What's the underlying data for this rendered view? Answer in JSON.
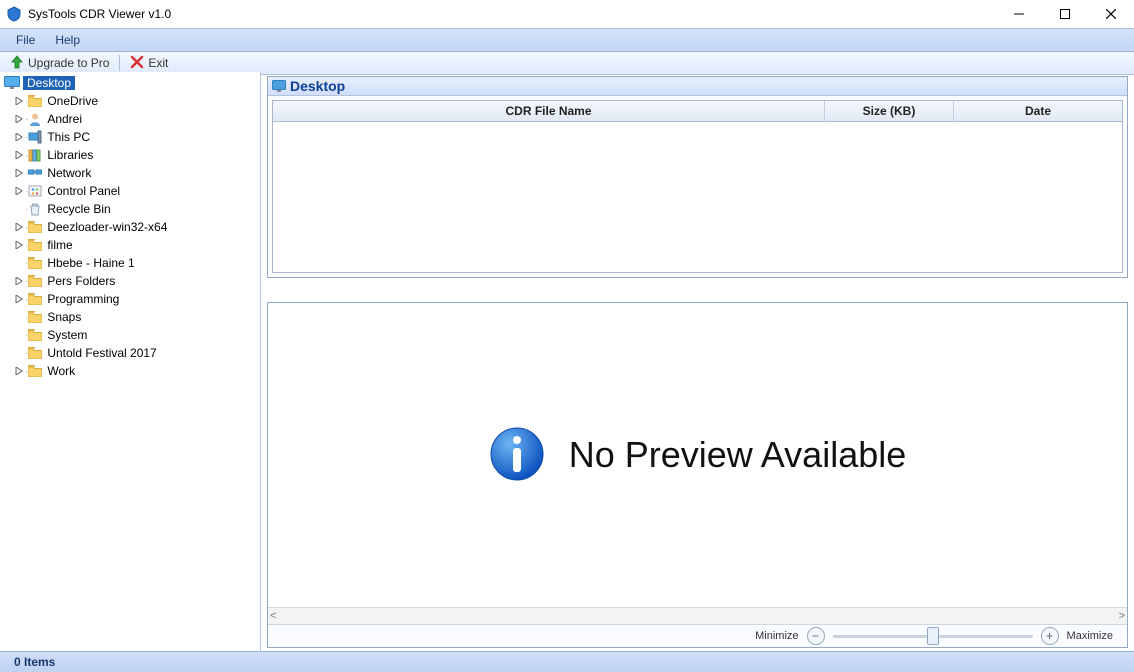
{
  "window": {
    "title": "SysTools CDR Viewer v1.0"
  },
  "menubar": {
    "file": "File",
    "help": "Help"
  },
  "toolbar": {
    "upgrade": "Upgrade to Pro",
    "exit": "Exit"
  },
  "sidebar": {
    "items": [
      {
        "label": "Desktop",
        "icon": "desktop",
        "depth": 0,
        "expander": "",
        "selected": true
      },
      {
        "label": "OneDrive",
        "icon": "folder",
        "depth": 1,
        "expander": ">"
      },
      {
        "label": "Andrei",
        "icon": "user",
        "depth": 1,
        "expander": ">"
      },
      {
        "label": "This PC",
        "icon": "pc",
        "depth": 1,
        "expander": ">"
      },
      {
        "label": "Libraries",
        "icon": "libraries",
        "depth": 1,
        "expander": ">"
      },
      {
        "label": "Network",
        "icon": "network",
        "depth": 1,
        "expander": ">"
      },
      {
        "label": "Control Panel",
        "icon": "control-panel",
        "depth": 1,
        "expander": ">"
      },
      {
        "label": "Recycle Bin",
        "icon": "recycle",
        "depth": 1,
        "expander": ""
      },
      {
        "label": "Deezloader-win32-x64",
        "icon": "folder",
        "depth": 1,
        "expander": ">"
      },
      {
        "label": "filme",
        "icon": "folder",
        "depth": 1,
        "expander": ">"
      },
      {
        "label": "Hbebe - Haine 1",
        "icon": "folder",
        "depth": 1,
        "expander": ""
      },
      {
        "label": "Pers Folders",
        "icon": "folder",
        "depth": 1,
        "expander": ">"
      },
      {
        "label": "Programming",
        "icon": "folder",
        "depth": 1,
        "expander": ">"
      },
      {
        "label": "Snaps",
        "icon": "folder",
        "depth": 1,
        "expander": ""
      },
      {
        "label": "System",
        "icon": "folder",
        "depth": 1,
        "expander": ""
      },
      {
        "label": "Untold Festival 2017",
        "icon": "folder",
        "depth": 1,
        "expander": ""
      },
      {
        "label": "Work",
        "icon": "folder",
        "depth": 1,
        "expander": ">"
      }
    ]
  },
  "list": {
    "title": "Desktop",
    "columns": {
      "name": "CDR File Name",
      "size": "Size (KB)",
      "date": "Date"
    },
    "rows": []
  },
  "preview": {
    "message": "No Preview Available",
    "minimize_label": "Minimize",
    "maximize_label": "Maximize"
  },
  "status": {
    "text": "0 Items"
  }
}
